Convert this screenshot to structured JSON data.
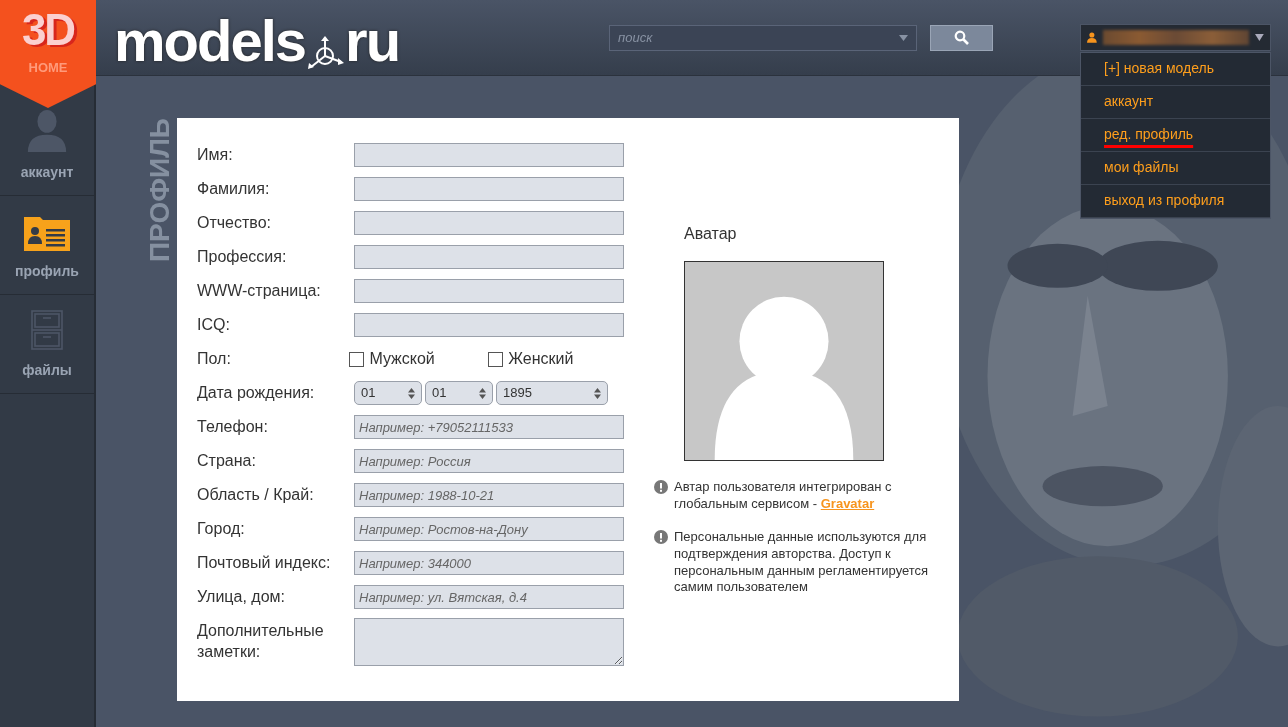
{
  "logo": {
    "big": "3D",
    "small": "HOME"
  },
  "site": {
    "name": "models",
    "tld": "ru"
  },
  "search": {
    "placeholder": "поиск"
  },
  "user_menu": {
    "items": [
      {
        "label": "[+] новая модель",
        "selected": false
      },
      {
        "label": "аккаунт",
        "selected": false
      },
      {
        "label": "ред. профиль",
        "selected": true
      },
      {
        "label": "мои файлы",
        "selected": false
      },
      {
        "label": "выход из профиля",
        "selected": false
      }
    ]
  },
  "sidebar": {
    "items": [
      {
        "label": "аккаунт",
        "kind": "person",
        "selected": false
      },
      {
        "label": "профиль",
        "kind": "card",
        "selected": true
      },
      {
        "label": "файлы",
        "kind": "cabinet",
        "selected": false
      }
    ]
  },
  "section_title": "ПРОФИЛЬ",
  "form": {
    "fields": [
      {
        "label": "Имя:",
        "kind": "text"
      },
      {
        "label": "Фамилия:",
        "kind": "text"
      },
      {
        "label": "Отчество:",
        "kind": "text"
      },
      {
        "label": "Профессия:",
        "kind": "text"
      },
      {
        "label": "WWW-страница:",
        "kind": "text"
      },
      {
        "label": "ICQ:",
        "kind": "text"
      },
      {
        "label": "Пол:",
        "kind": "checkboxes",
        "options": [
          {
            "label": "Мужской",
            "checked": false
          },
          {
            "label": "Женский",
            "checked": false
          }
        ]
      },
      {
        "label": "Дата рождения:",
        "kind": "date",
        "values": [
          "01",
          "01",
          "1895"
        ]
      },
      {
        "label": "Телефон:",
        "kind": "text",
        "placeholder": "Например: +79052111533"
      },
      {
        "label": "Страна:",
        "kind": "text",
        "placeholder": "Например: Россия"
      },
      {
        "label": "Область / Край:",
        "kind": "text",
        "placeholder": "Например: 1988-10-21"
      },
      {
        "label": "Город:",
        "kind": "text",
        "placeholder": "Например: Ростов-на-Дону"
      },
      {
        "label": "Почтовый индекс:",
        "kind": "text",
        "placeholder": "Например: 344000"
      },
      {
        "label": "Улица, дом:",
        "kind": "text",
        "placeholder": "Например: ул. Вятская, д.4"
      },
      {
        "label": "Дополнительные заметки:",
        "kind": "textarea"
      }
    ]
  },
  "avatar": {
    "title": "Аватар"
  },
  "notes": [
    {
      "text": "Автар пользователя интегрирован с глобальным сервисом - ",
      "link": "Gravatar"
    },
    {
      "text": "Персональные данные используются для подтверждения авторства. Доступ к персональным данным регламентируется самим пользователем"
    }
  ]
}
